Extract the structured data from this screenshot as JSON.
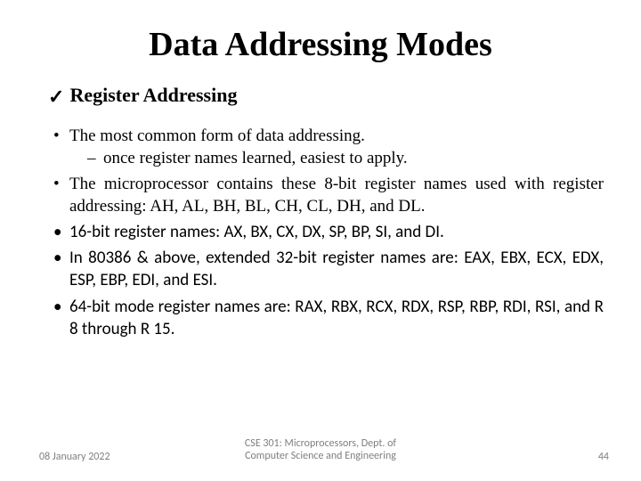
{
  "title": "Data Addressing Modes",
  "subhead": "Register Addressing",
  "bullets": {
    "b1": "The most common form of data addressing.",
    "b1_sub": "once register names learned, easiest to apply.",
    "b2": "The microprocessor contains these 8-bit register names used with register addressing: AH, AL, BH, BL, CH, CL, DH, and DL.",
    "b3": "16-bit register names: AX, BX, CX, DX, SP, BP, SI, and DI.",
    "b4": " In 80386 & above, extended 32-bit register names are: EAX, EBX, ECX, EDX, ESP, EBP, EDI, and ESI.",
    "b5": "64-bit mode register names are: RAX, RBX, RCX, RDX, RSP, RBP, RDI, RSI, and R 8 through R 15."
  },
  "footer": {
    "date": "08 January 2022",
    "center_l1": "CSE 301: Microprocessors, Dept. of",
    "center_l2": "Computer Science and Engineering",
    "page": "44"
  }
}
